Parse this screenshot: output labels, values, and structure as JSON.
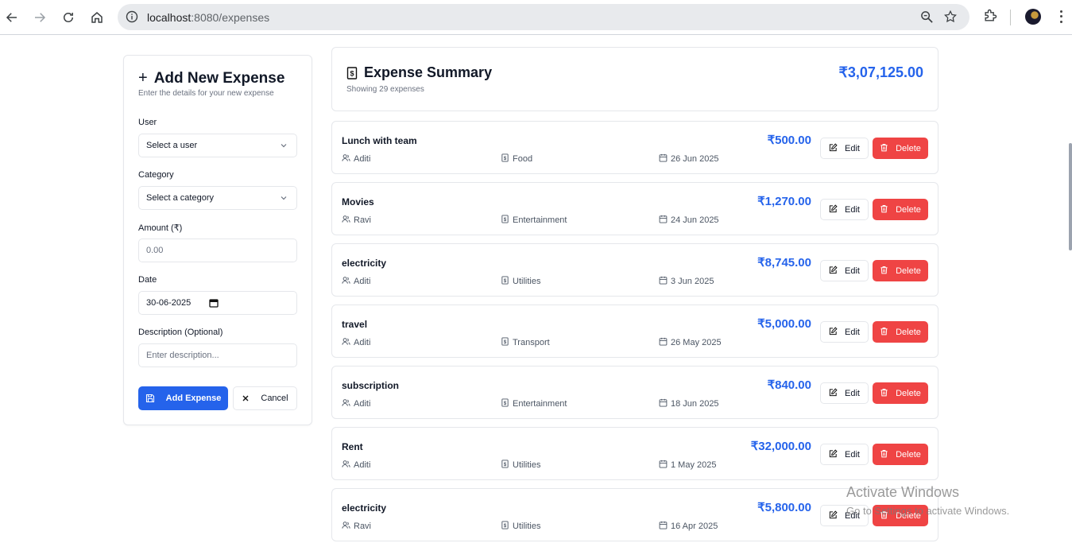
{
  "browser": {
    "url_host": "localhost",
    "url_path": ":8080/expenses"
  },
  "form": {
    "title": "Add New Expense",
    "subtitle": "Enter the details for your new expense",
    "user_label": "User",
    "user_value": "Select a user",
    "category_label": "Category",
    "category_value": "Select a category",
    "amount_label": "Amount (₹)",
    "amount_placeholder": "0.00",
    "date_label": "Date",
    "date_value": "30-06-2025",
    "description_label": "Description (Optional)",
    "description_placeholder": "Enter description...",
    "add_button": "Add Expense",
    "cancel_button": "Cancel"
  },
  "summary": {
    "title": "Expense Summary",
    "subtitle": "Showing 29 expenses",
    "total": "₹3,07,125.00"
  },
  "expenses": [
    {
      "name": "Lunch with team",
      "user": "Aditi",
      "category": "Food",
      "date": "26 Jun 2025",
      "amount": "₹500.00"
    },
    {
      "name": "Movies",
      "user": "Ravi",
      "category": "Entertainment",
      "date": "24 Jun 2025",
      "amount": "₹1,270.00"
    },
    {
      "name": "electricity",
      "user": "Aditi",
      "category": "Utilities",
      "date": "3 Jun 2025",
      "amount": "₹8,745.00"
    },
    {
      "name": "travel",
      "user": "Aditi",
      "category": "Transport",
      "date": "26 May 2025",
      "amount": "₹5,000.00"
    },
    {
      "name": "subscription",
      "user": "Aditi",
      "category": "Entertainment",
      "date": "18 Jun 2025",
      "amount": "₹840.00"
    },
    {
      "name": "Rent",
      "user": "Aditi",
      "category": "Utilities",
      "date": "1 May 2025",
      "amount": "₹32,000.00"
    },
    {
      "name": "electricity",
      "user": "Ravi",
      "category": "Utilities",
      "date": "16 Apr 2025",
      "amount": "₹5,800.00"
    }
  ],
  "row_actions": {
    "edit": "Edit",
    "delete": "Delete"
  },
  "watermark": {
    "line1": "Activate Windows",
    "line2": "Go to Settings to activate Windows."
  },
  "colors": {
    "accent": "#2563eb",
    "danger": "#ef4444"
  }
}
